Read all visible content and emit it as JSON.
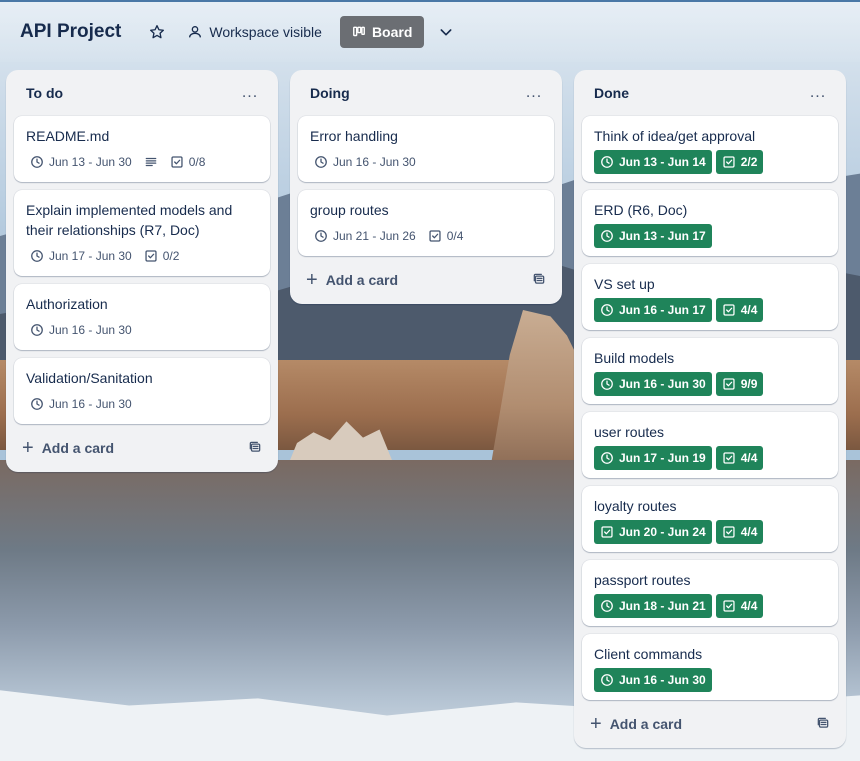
{
  "header": {
    "title": "API Project",
    "visibility_label": "Workspace visible",
    "view_label": "Board"
  },
  "icons": {
    "star": "star-icon",
    "visibility": "people-icon",
    "board": "board-icon",
    "chevron": "chevron-down-icon",
    "clock": "clock-icon",
    "checklist": "checkbox-icon",
    "description": "description-icon",
    "template": "template-icon",
    "more": "more-icon"
  },
  "colors": {
    "due_complete": "#1f845a",
    "list_bg": "#f1f2f4",
    "view_button": "#6b6e73"
  },
  "add_card_label": "Add a card",
  "list_menu": "...",
  "lists": [
    {
      "title": "To do",
      "cards": [
        {
          "title": "README.md",
          "dates": "Jun 13 - Jun 30",
          "checklist": "0/8",
          "has_description": true
        },
        {
          "title": "Explain implemented models and their relationships (R7, Doc)",
          "dates": "Jun 17 - Jun 30",
          "checklist": "0/2"
        },
        {
          "title": "Authorization",
          "dates": "Jun 16 - Jun 30"
        },
        {
          "title": "Validation/Sanitation",
          "dates": "Jun 16 - Jun 30"
        }
      ]
    },
    {
      "title": "Doing",
      "cards": [
        {
          "title": "Error handling",
          "dates": "Jun 16 - Jun 30"
        },
        {
          "title": "group routes",
          "dates": "Jun 21 - Jun 26",
          "checklist": "0/4"
        }
      ]
    },
    {
      "title": "Done",
      "cards": [
        {
          "title": "Think of idea/get approval",
          "dates": "Jun 13 - Jun 14",
          "checklist": "2/2",
          "complete": true
        },
        {
          "title": "ERD (R6, Doc)",
          "dates": "Jun 13 - Jun 17",
          "complete": true
        },
        {
          "title": "VS set up",
          "dates": "Jun 16 - Jun 17",
          "checklist": "4/4",
          "complete": true
        },
        {
          "title": "Build models",
          "dates": "Jun 16 - Jun 30",
          "checklist": "9/9",
          "complete": true
        },
        {
          "title": "user routes",
          "dates": "Jun 17 - Jun 19",
          "checklist": "4/4",
          "complete": true
        },
        {
          "title": "loyalty routes",
          "dates": "Jun 20 - Jun 24",
          "checklist": "4/4",
          "complete": true,
          "date_icon": "checkbox-icon"
        },
        {
          "title": "passport routes",
          "dates": "Jun 18 - Jun 21",
          "checklist": "4/4",
          "complete": true
        },
        {
          "title": "Client commands",
          "dates": "Jun 16 - Jun 30",
          "complete": true
        }
      ]
    }
  ]
}
